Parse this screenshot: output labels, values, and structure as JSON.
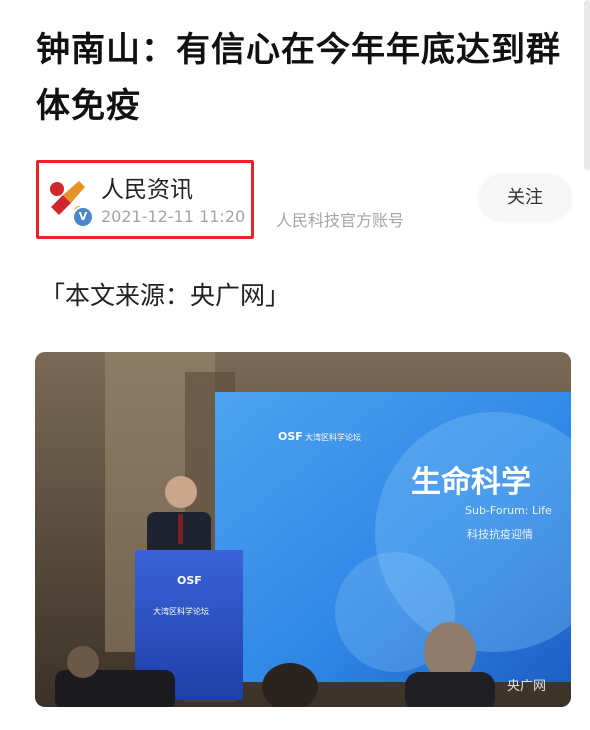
{
  "article": {
    "title": "钟南山：有信心在今年年底达到群体免疫",
    "source": "「本文来源：央广网」"
  },
  "author": {
    "name": "人民资讯",
    "time": "2021-12-11 11:20",
    "description": "人民科技官方账号",
    "verified_mark": "V",
    "follow_label": "关注"
  },
  "photo": {
    "podium_logo": "OSF",
    "podium_text": "大湾区科学论坛",
    "screen_logo": "OSF",
    "screen_banner": "大湾区科学论坛",
    "screen_title": "生命科学",
    "screen_subtitle": "Sub-Forum: Life",
    "screen_line": "科技抗疫迎情",
    "watermark": "央广网"
  },
  "colors": {
    "highlight_border": "#e8232a",
    "verified_badge": "#4a86c8",
    "screen_blue": "#2f86e6"
  },
  "icons": {
    "avatar": "people-news-logo-icon",
    "verified": "verified-badge-icon"
  }
}
